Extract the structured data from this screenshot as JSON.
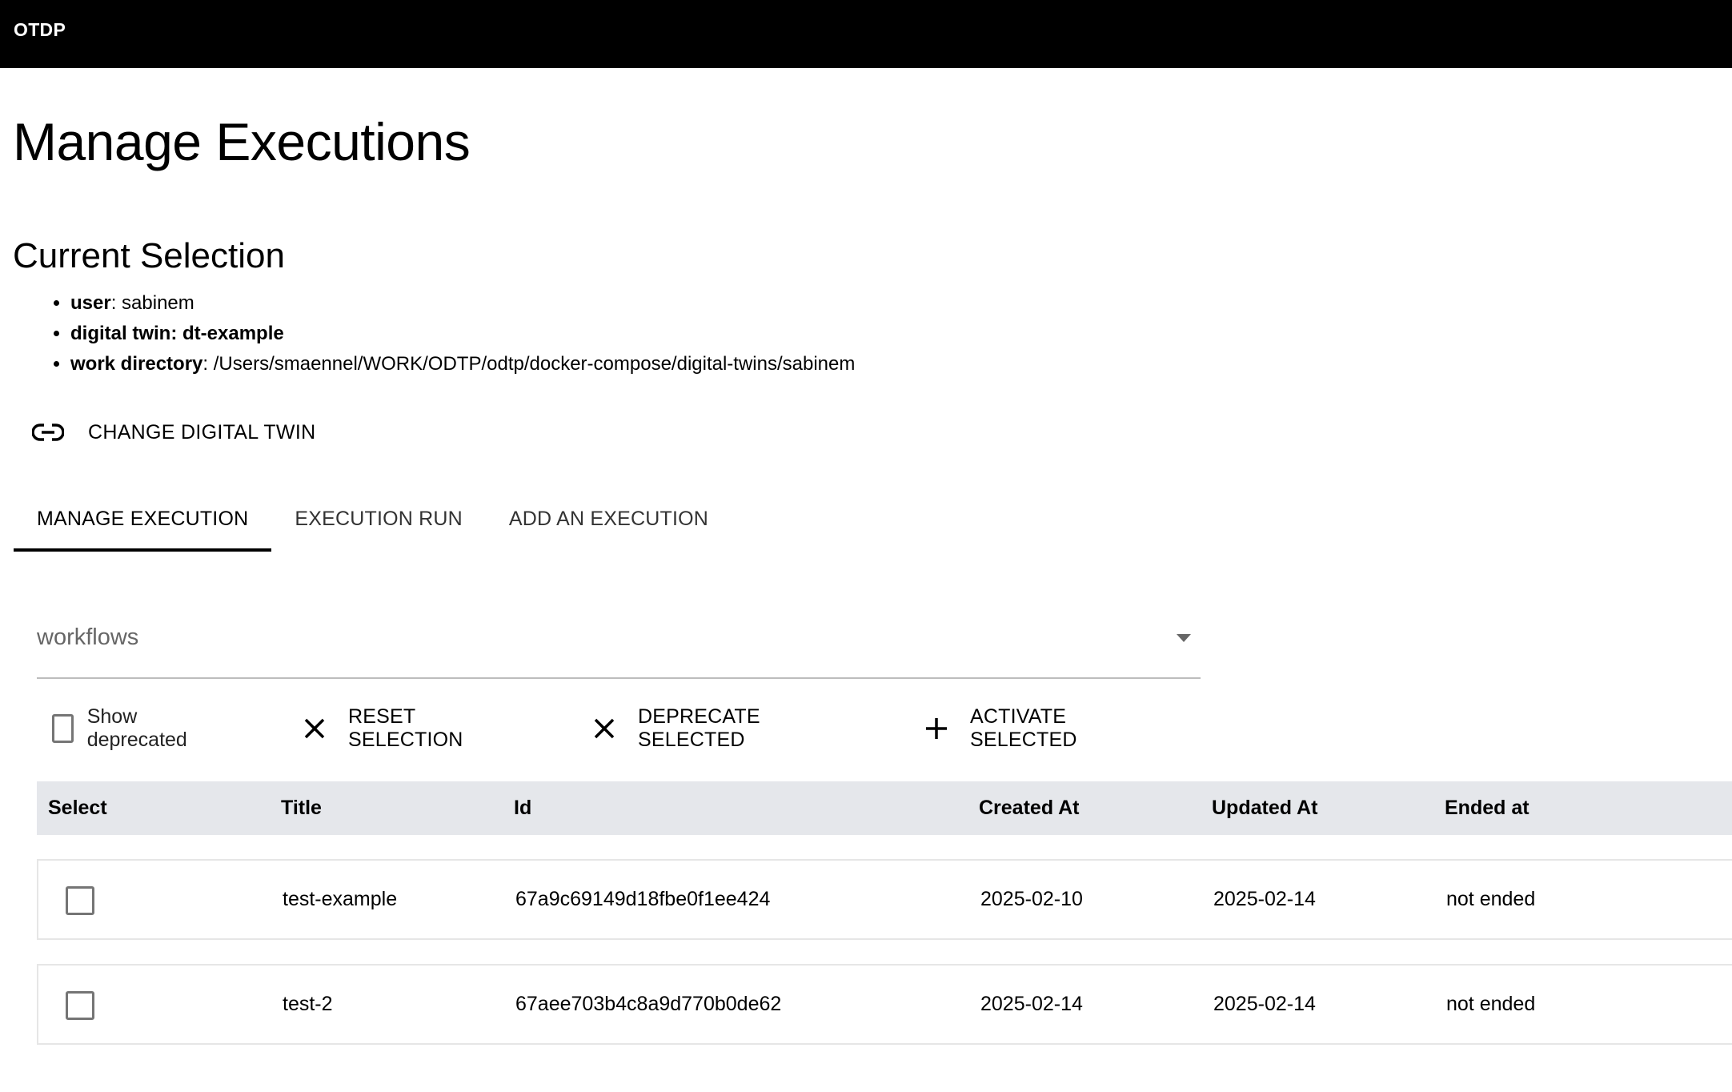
{
  "appbar": {
    "brand": "OTDP"
  },
  "page": {
    "title": "Manage Executions"
  },
  "current_selection": {
    "title": "Current Selection",
    "items": [
      {
        "key": "user",
        "value": "sabinem",
        "value_bold": false
      },
      {
        "key": "digital twin",
        "value": "dt-example",
        "value_bold": true
      },
      {
        "key": "work directory",
        "value": "/Users/smaennel/WORK/ODTP/odtp/docker-compose/digital-twins/sabinem",
        "value_bold": false
      }
    ]
  },
  "change_button": {
    "label": "CHANGE DIGITAL TWIN",
    "icon": "link-icon"
  },
  "tabs": [
    {
      "label": "MANAGE EXECUTION",
      "active": true
    },
    {
      "label": "EXECUTION RUN",
      "active": false
    },
    {
      "label": "ADD AN EXECUTION",
      "active": false
    }
  ],
  "workflow_select": {
    "value": "workflows",
    "icon": "dropdown-arrow-icon"
  },
  "toolbar": {
    "show_deprecated": {
      "label": "Show deprecated",
      "checked": false
    },
    "reset": {
      "label": "RESET SELECTION",
      "icon": "close-icon"
    },
    "deprecate": {
      "label": "DEPRECATE SELECTED",
      "icon": "close-icon"
    },
    "activate": {
      "label": "ACTIVATE SELECTED",
      "icon": "plus-icon"
    }
  },
  "table": {
    "columns": [
      "Select",
      "Title",
      "Id",
      "Created At",
      "Updated At",
      "Ended at"
    ],
    "rows": [
      {
        "selected": false,
        "title": "test-example",
        "id": "67a9c69149d18fbe0f1ee424",
        "created_at": "2025-02-10",
        "updated_at": "2025-02-14",
        "ended_at": "not ended"
      },
      {
        "selected": false,
        "title": "test-2",
        "id": "67aee703b4c8a9d770b0de62",
        "created_at": "2025-02-14",
        "updated_at": "2025-02-14",
        "ended_at": "not ended"
      }
    ]
  }
}
